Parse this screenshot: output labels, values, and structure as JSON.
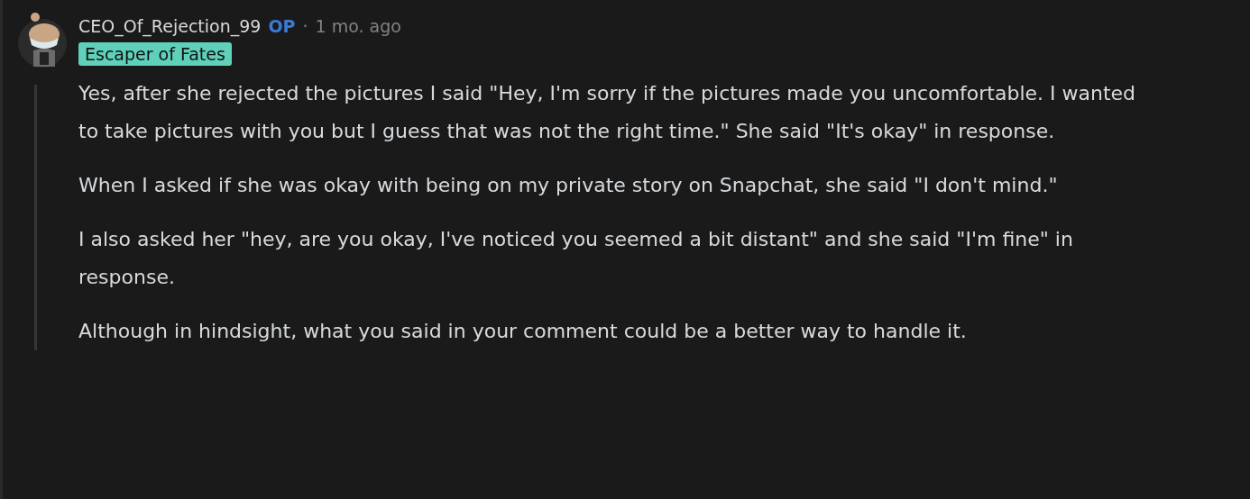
{
  "comment": {
    "author": "CEO_Of_Rejection_99",
    "op_badge": "OP",
    "separator": "·",
    "time": "1 mo. ago",
    "flair": "Escaper of Fates",
    "paragraphs": [
      "Yes, after she rejected the pictures I said \"Hey, I'm sorry if the pictures made you uncomfortable. I wanted to take pictures with you but I guess that was not the right time.\" She said \"It's okay\" in response.",
      "When I asked if she was okay with being on my private story on Snapchat, she said \"I don't mind.\"",
      "I also asked her \"hey, are you okay, I've noticed you seemed a bit distant\" and she said \"I'm fine\" in response.",
      "Although in hindsight, what you said in your comment could be a better way to handle it."
    ]
  }
}
